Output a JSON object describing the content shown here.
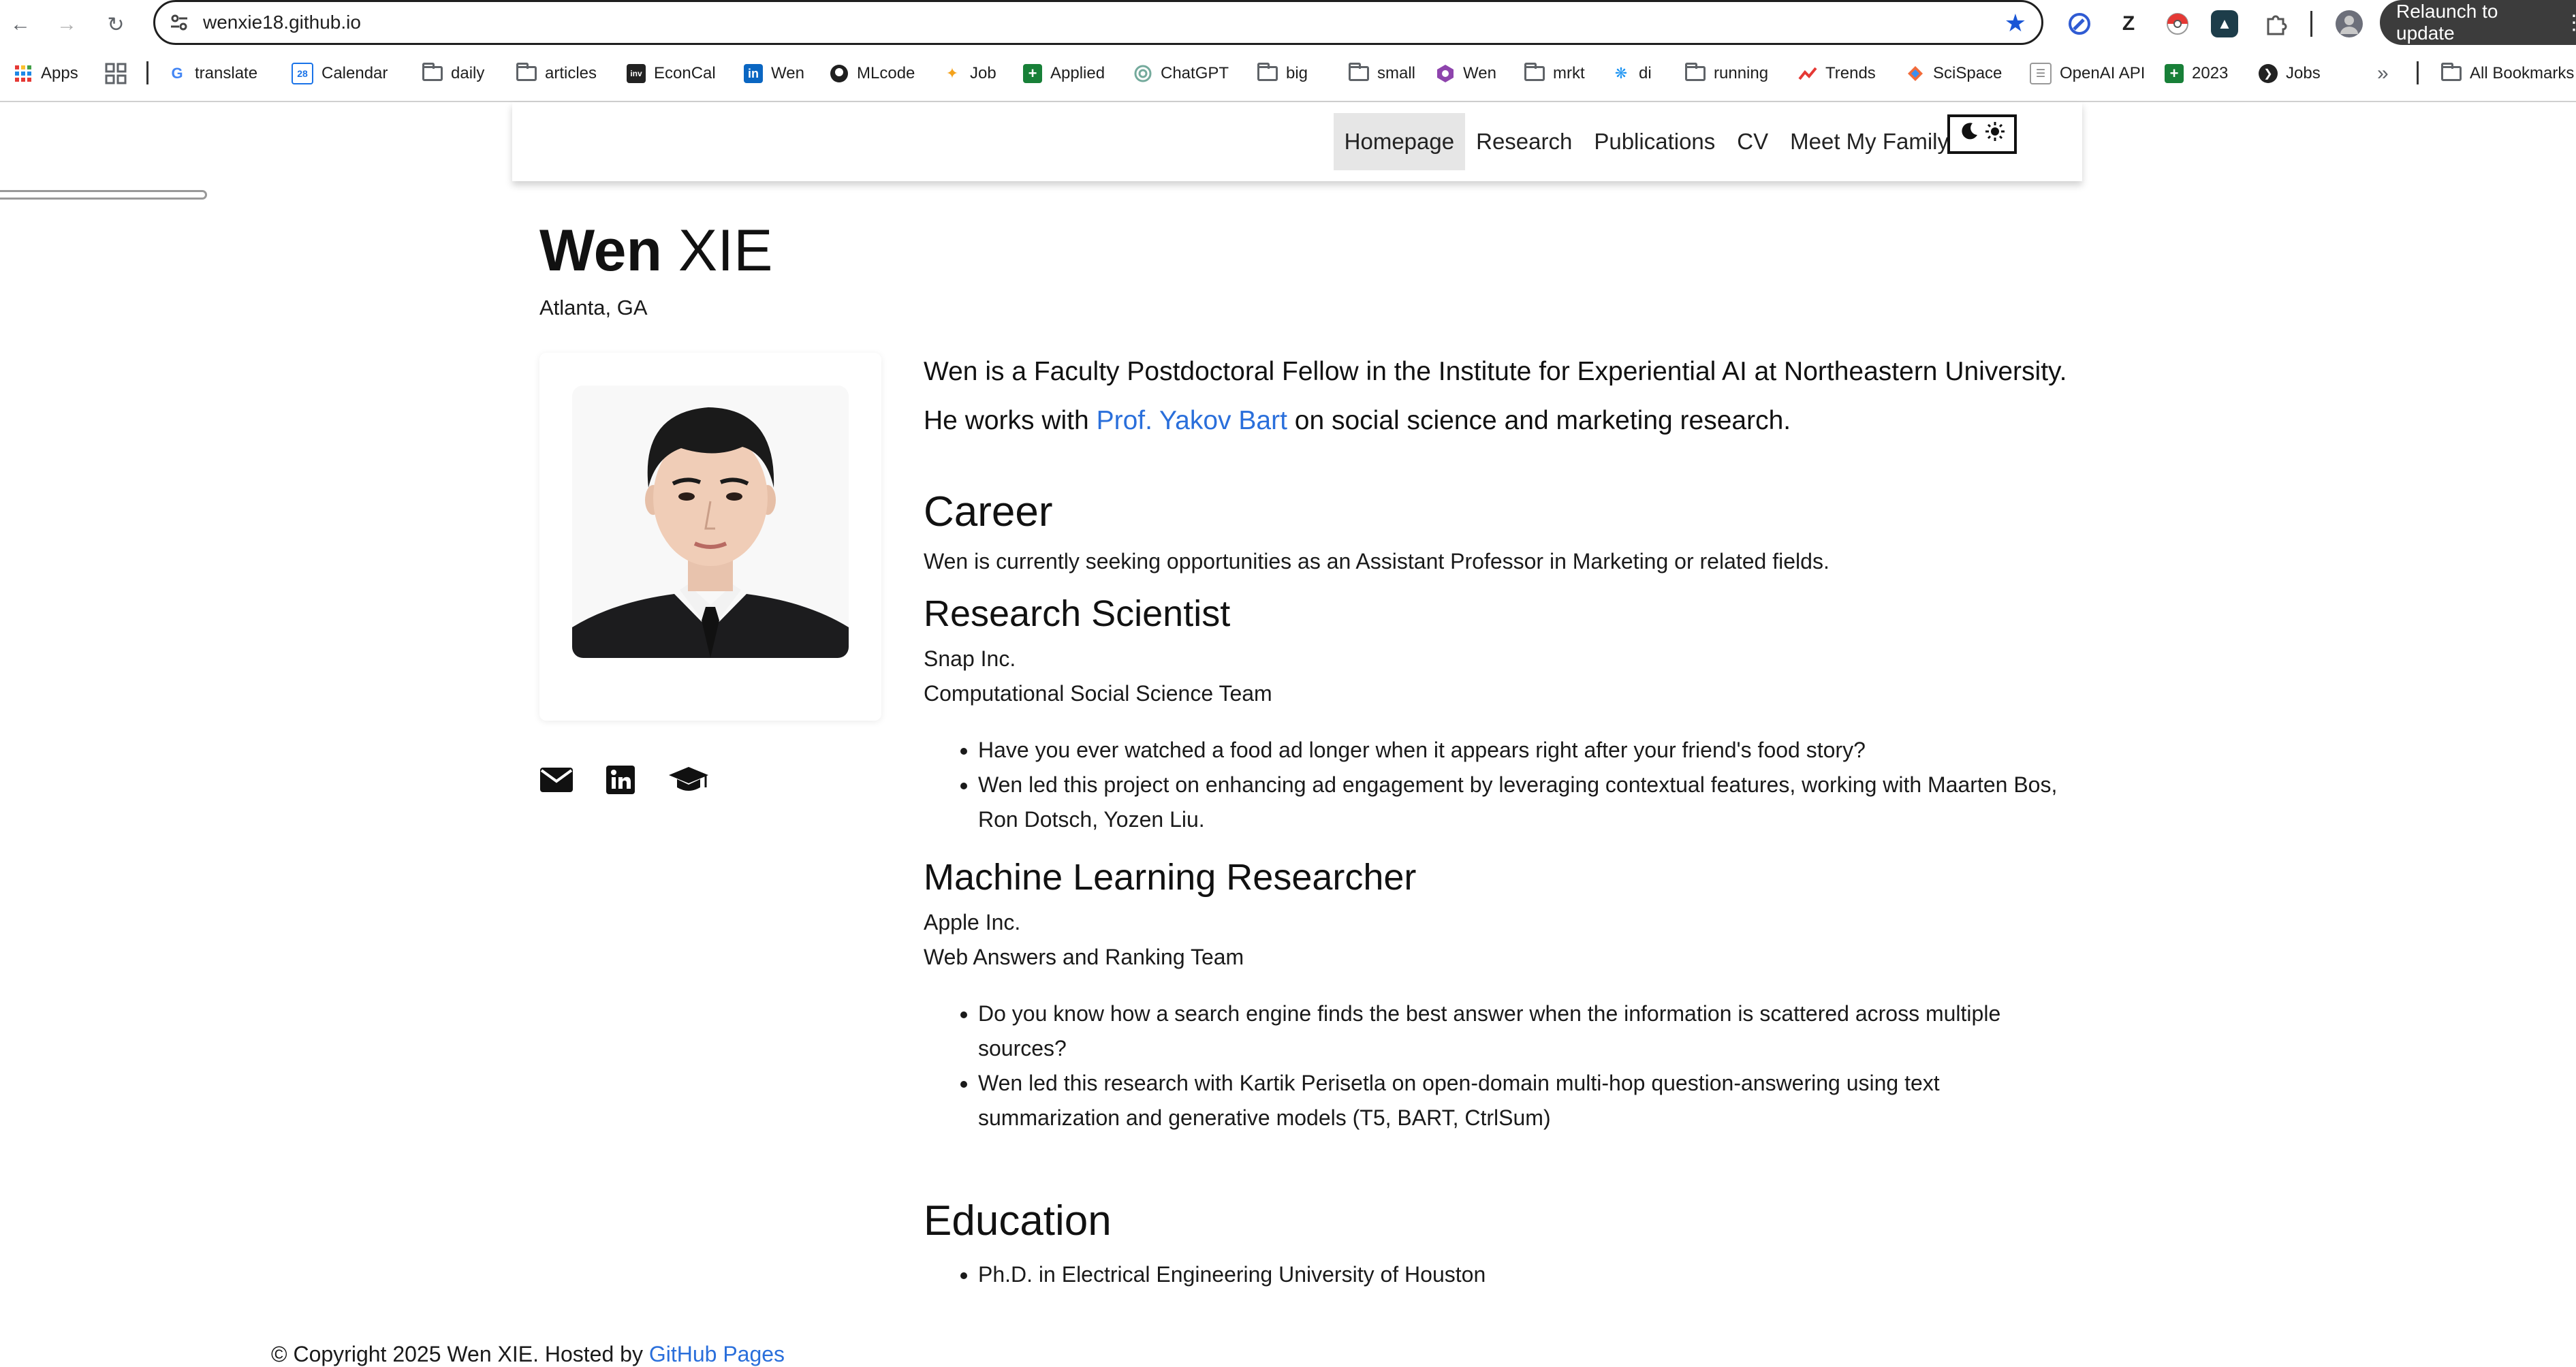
{
  "browser": {
    "url": "wenxie18.github.io",
    "relaunch_label": "Relaunch to update",
    "bookmarks": [
      {
        "label": "Apps"
      },
      {
        "label": "translate"
      },
      {
        "label": "Calendar"
      },
      {
        "label": "daily"
      },
      {
        "label": "articles"
      },
      {
        "label": "EconCal"
      },
      {
        "label": "Wen"
      },
      {
        "label": "MLcode"
      },
      {
        "label": "Job"
      },
      {
        "label": "Applied"
      },
      {
        "label": "ChatGPT"
      },
      {
        "label": "big"
      },
      {
        "label": "small"
      },
      {
        "label": "Wen"
      },
      {
        "label": "mrkt"
      },
      {
        "label": "di"
      },
      {
        "label": "running"
      },
      {
        "label": "Trends"
      },
      {
        "label": "SciSpace"
      },
      {
        "label": "OpenAI API"
      },
      {
        "label": "2023"
      },
      {
        "label": "Jobs"
      }
    ],
    "overflow_label": "»",
    "all_bookmarks_label": "All Bookmarks",
    "calendar_day": "28",
    "econcal_badge": "inv",
    "extension_z": "Z"
  },
  "nav": {
    "items": [
      {
        "label": "Homepage"
      },
      {
        "label": "Research"
      },
      {
        "label": "Publications"
      },
      {
        "label": "CV"
      },
      {
        "label": "Meet My Family"
      }
    ]
  },
  "profile": {
    "first_name": "Wen",
    "last_name": "XIE",
    "location": "Atlanta, GA"
  },
  "intro": {
    "text_before": "Wen is a Faculty Postdoctoral Fellow in the Institute for Experiential AI at Northeastern University. He works with ",
    "link_text": "Prof. Yakov Bart",
    "text_after": " on social science and marketing research."
  },
  "career": {
    "heading": "Career",
    "summary": "Wen is currently seeking opportunities as an Assistant Professor in Marketing or related fields.",
    "positions": [
      {
        "title": "Research Scientist",
        "company": "Snap Inc.",
        "team": "Computational Social Science Team",
        "bullets": [
          "Have you ever watched a food ad longer when it appears right after your friend's food story?",
          "Wen led this project on enhancing ad engagement by leveraging contextual features, working with Maarten Bos, Ron Dotsch, Yozen Liu."
        ]
      },
      {
        "title": "Machine Learning Researcher",
        "company": "Apple Inc.",
        "team": "Web Answers and Ranking Team",
        "bullets": [
          "Do you know how a search engine finds the best answer when the information is scattered across multiple sources?",
          "Wen led this research with Kartik Perisetla on open-domain multi-hop question-answering using text summarization and generative models (T5, BART, CtrlSum)"
        ]
      }
    ]
  },
  "education": {
    "heading": "Education",
    "items": [
      "Ph.D. in Electrical Engineering University of Houston"
    ]
  },
  "footer": {
    "text": "© Copyright 2025 Wen XIE. Hosted by ",
    "link_text": "GitHub Pages"
  },
  "colors": {
    "link": "#2a6fdb",
    "nav_active_bg": "#e6e6e6",
    "star": "#1a56d6"
  }
}
